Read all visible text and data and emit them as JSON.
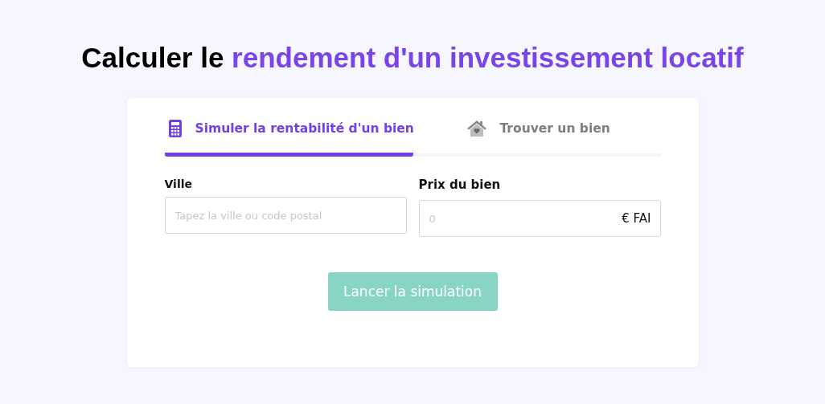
{
  "heading": {
    "text": "Calculer le ",
    "highlight": "rendement d'un investissement locatif"
  },
  "tabs": [
    {
      "label": "Simuler la rentabilité d'un bien",
      "kind": "calculator",
      "selected": true
    },
    {
      "label": "Trouver un bien",
      "kind": "house",
      "selected": false
    }
  ],
  "fields": [
    {
      "label": "Ville",
      "placeholder": "Tapez la ville ou code postal"
    },
    {
      "label": "Prix du bien",
      "placeholder": "0",
      "suffix": "€ FAI"
    }
  ],
  "submit": {
    "label": "Lancer la simulation",
    "disabled": true
  }
}
